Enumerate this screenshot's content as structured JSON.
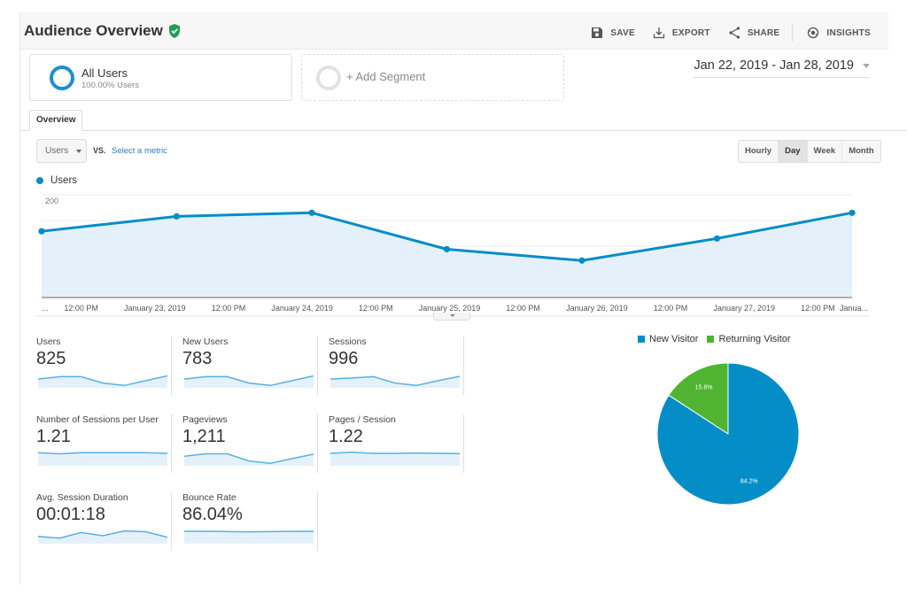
{
  "header": {
    "title": "Audience Overview",
    "verified_icon": "shield-check-icon",
    "toolbar": [
      {
        "label": "SAVE",
        "icon": "save-icon"
      },
      {
        "label": "EXPORT",
        "icon": "download-icon"
      },
      {
        "label": "SHARE",
        "icon": "share-icon"
      },
      {
        "label": "INSIGHTS",
        "icon": "insights-icon"
      }
    ]
  },
  "segments": {
    "all_users": {
      "name": "All Users",
      "sub": "100.00% Users"
    },
    "add_segment": "+ Add Segment"
  },
  "date_range": "Jan 22, 2019 - Jan 28, 2019",
  "tabs": [
    {
      "label": "Overview",
      "active": true
    }
  ],
  "metric_controls": {
    "selected_metric": "Users",
    "vs_label": "VS.",
    "select_metric_link": "Select a metric"
  },
  "granularity": [
    {
      "label": "Hourly",
      "active": false
    },
    {
      "label": "Day",
      "active": true
    },
    {
      "label": "Week",
      "active": false
    },
    {
      "label": "Month",
      "active": false
    }
  ],
  "colors": {
    "primary_blue": "#058dc7",
    "area_fill": "#e5f1fa",
    "returning_green": "#50b432",
    "sparkline": "#58b1e0"
  },
  "chart_data": [
    {
      "type": "area",
      "title": "",
      "legend": [
        "Users"
      ],
      "legend_position": "top-left",
      "ylim": [
        0,
        200
      ],
      "yticks": [
        100,
        200
      ],
      "grid": true,
      "x_tick_labels": [
        "...",
        "12:00 PM",
        "January 23, 2019",
        "12:00 PM",
        "January 24, 2019",
        "12:00 PM",
        "January 25, 2019",
        "12:00 PM",
        "January 26, 2019",
        "12:00 PM",
        "January 27, 2019",
        "12:00 PM",
        "Janua..."
      ],
      "x": [
        "January 22, 2019",
        "January 23, 2019",
        "January 24, 2019",
        "January 25, 2019",
        "January 26, 2019",
        "January 27, 2019",
        "January 28, 2019"
      ],
      "series": [
        {
          "name": "Users",
          "values": [
            129,
            158,
            165,
            94,
            72,
            115,
            165
          ]
        }
      ]
    },
    {
      "type": "pie",
      "legend": [
        "New Visitor",
        "Returning Visitor"
      ],
      "legend_position": "top",
      "slices": [
        {
          "label": "New Visitor",
          "value": 84.2,
          "display": "84.2%"
        },
        {
          "label": "Returning Visitor",
          "value": 15.8,
          "display": "15.8%"
        }
      ]
    }
  ],
  "metrics": [
    {
      "label": "Users",
      "value": "825",
      "spark": [
        0.55,
        0.7,
        0.7,
        0.3,
        0.15,
        0.45,
        0.75
      ]
    },
    {
      "label": "New Users",
      "value": "783",
      "spark": [
        0.55,
        0.7,
        0.7,
        0.3,
        0.15,
        0.45,
        0.75
      ]
    },
    {
      "label": "Sessions",
      "value": "996",
      "spark": [
        0.55,
        0.62,
        0.7,
        0.3,
        0.15,
        0.45,
        0.72
      ]
    },
    {
      "label": "Number of Sessions per User",
      "value": "1.21",
      "spark": [
        0.82,
        0.75,
        0.82,
        0.82,
        0.82,
        0.82,
        0.78
      ]
    },
    {
      "label": "Pageviews",
      "value": "1,211",
      "spark": [
        0.6,
        0.75,
        0.75,
        0.3,
        0.15,
        0.45,
        0.72
      ]
    },
    {
      "label": "Pages / Session",
      "value": "1.22",
      "spark": [
        0.78,
        0.85,
        0.78,
        0.78,
        0.8,
        0.78,
        0.76
      ]
    },
    {
      "label": "Avg. Session Duration",
      "value": "00:01:18",
      "spark": [
        0.45,
        0.35,
        0.7,
        0.5,
        0.8,
        0.75,
        0.4
      ]
    },
    {
      "label": "Bounce Rate",
      "value": "86.04%",
      "spark": [
        0.78,
        0.78,
        0.76,
        0.74,
        0.76,
        0.77,
        0.78
      ]
    }
  ]
}
